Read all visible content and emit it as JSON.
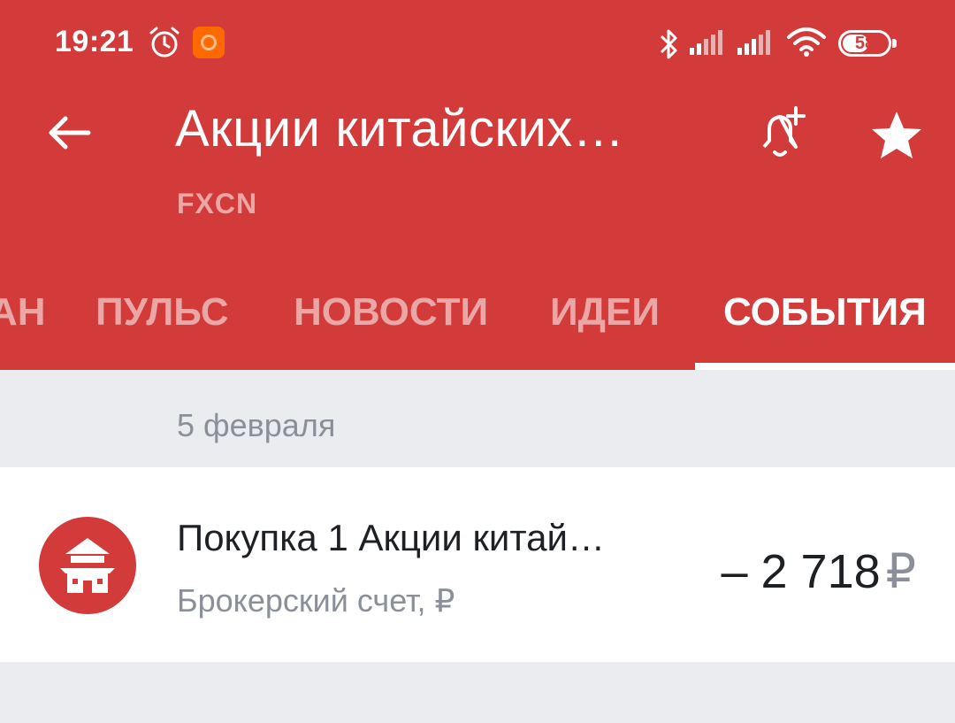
{
  "status_bar": {
    "time": "19:21",
    "battery": "58",
    "battery_level_fraction": 0.58,
    "icons": [
      "alarm-icon",
      "mi-app-icon",
      "bluetooth-icon",
      "signal-icon",
      "signal-icon",
      "wifi-icon",
      "battery-icon"
    ]
  },
  "header": {
    "title": "Акции китайских…",
    "ticker": "FXCN",
    "back_icon": "arrow-left-icon",
    "alert_icon": "bell-plus-icon",
    "favorite_icon": "star-icon"
  },
  "tabs": [
    {
      "label": "АН",
      "active": false
    },
    {
      "label": "ПУЛЬС",
      "active": false
    },
    {
      "label": "НОВОСТИ",
      "active": false
    },
    {
      "label": "ИДЕИ",
      "active": false
    },
    {
      "label": "СОБЫТИЯ",
      "active": true
    }
  ],
  "events": {
    "date": "5 февраля",
    "operations": [
      {
        "title": "Покупка 1 Акции китай…",
        "account": "Брокерский счет, ₽",
        "amount": "– 2 718",
        "currency": "₽",
        "icon": "pagoda-icon"
      }
    ]
  },
  "colors": {
    "brand_red": "#d33a3a",
    "background": "#ebecef",
    "text_primary": "#1d2025",
    "text_secondary": "#8a8f99",
    "status_orange": "#ff6a00"
  }
}
